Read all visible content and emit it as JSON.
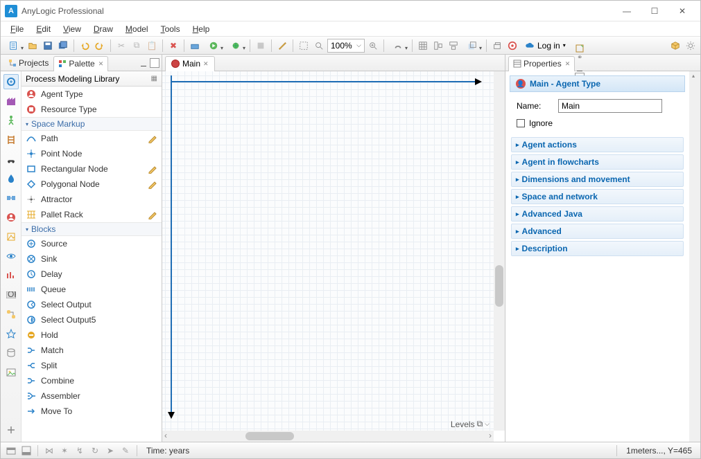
{
  "window": {
    "title": "AnyLogic Professional"
  },
  "menu": [
    "File",
    "Edit",
    "View",
    "Draw",
    "Model",
    "Tools",
    "Help"
  ],
  "toolbar": {
    "zoom": "100%",
    "login": "Log in"
  },
  "left": {
    "tabs": {
      "projects": "Projects",
      "palette": "Palette"
    },
    "palette_header": "Process Modeling Library",
    "groups": {
      "space_markup": "Space Markup",
      "blocks": "Blocks"
    },
    "items": {
      "agent_type": "Agent Type",
      "resource_type": "Resource Type",
      "path": "Path",
      "point_node": "Point Node",
      "rect_node": "Rectangular Node",
      "poly_node": "Polygonal Node",
      "attractor": "Attractor",
      "pallet_rack": "Pallet Rack",
      "source": "Source",
      "sink": "Sink",
      "delay": "Delay",
      "queue": "Queue",
      "select_output": "Select Output",
      "select_output5": "Select Output5",
      "hold": "Hold",
      "match": "Match",
      "split": "Split",
      "combine": "Combine",
      "assembler": "Assembler",
      "move_to": "Move To"
    }
  },
  "editor": {
    "tab": "Main",
    "levels_label": "Levels"
  },
  "props": {
    "tab": "Properties",
    "title": "Main - Agent Type",
    "name_label": "Name:",
    "name_value": "Main",
    "ignore": "Ignore",
    "sections": [
      "Agent actions",
      "Agent in flowcharts",
      "Dimensions and movement",
      "Space and network",
      "Advanced Java",
      "Advanced",
      "Description"
    ]
  },
  "status": {
    "time": "Time: years",
    "coords": "1meters..., Y=465"
  }
}
